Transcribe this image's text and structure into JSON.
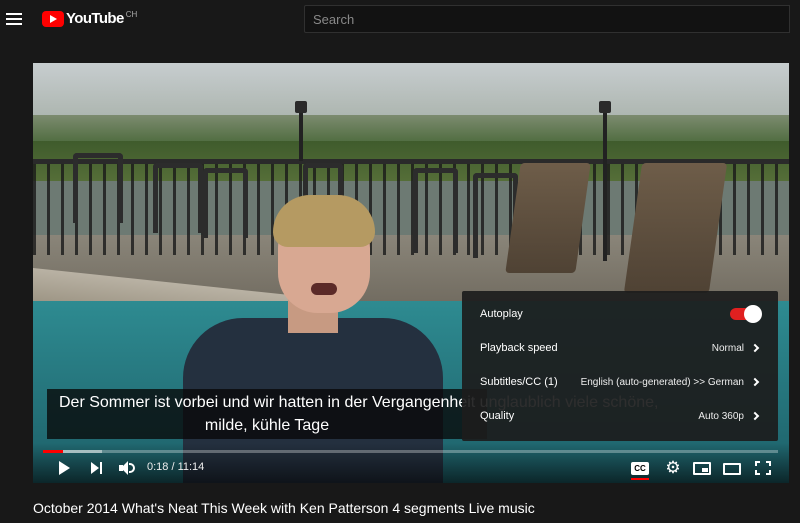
{
  "header": {
    "logo_text": "YouTube",
    "country_code": "CH",
    "search_placeholder": "Search"
  },
  "caption": {
    "line1": "Der Sommer ist vorbei und wir hatten in der Vergangenheit unglaublich viele schöne,",
    "line2": "milde, kühle Tage"
  },
  "settings": {
    "autoplay_label": "Autoplay",
    "autoplay_on": true,
    "playback_speed_label": "Playback speed",
    "playback_speed_value": "Normal",
    "subtitles_label": "Subtitles/CC (1)",
    "subtitles_value": "English (auto-generated) >> German",
    "quality_label": "Quality",
    "quality_value": "Auto 360p"
  },
  "controls": {
    "current_time": "0:18",
    "duration": "11:14",
    "time_display": "0:18 / 11:14",
    "played_fraction": 0.027,
    "buffered_fraction": 0.08,
    "cc_label": "CC",
    "settings_icon_glyph": "⚙"
  },
  "video": {
    "title": "October 2014 What's Neat This Week with Ken Patterson 4 segments Live music"
  },
  "colors": {
    "background": "#181818",
    "brand_red": "#ff0000",
    "progress_red": "#f00"
  }
}
